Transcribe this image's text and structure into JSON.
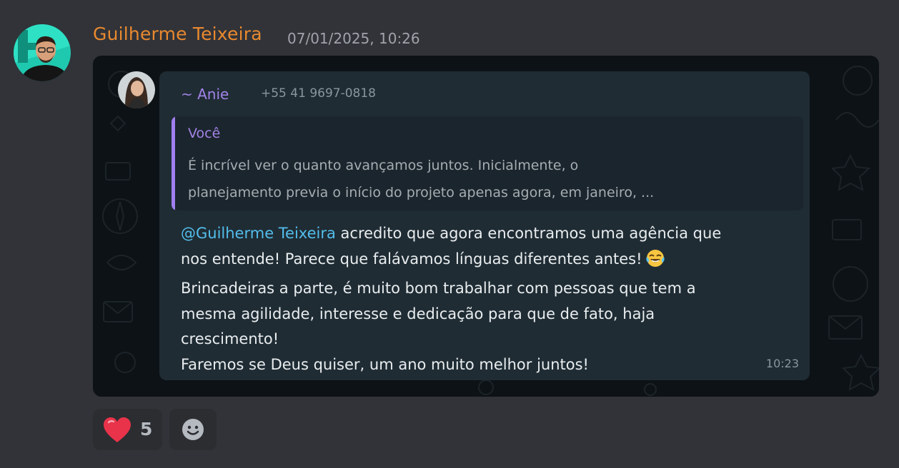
{
  "message": {
    "author": "Guilherme Teixeira",
    "timestamp": "07/01/2025, 10:26"
  },
  "attachment": {
    "sender_name": "~ Anie",
    "sender_phone": "+55 41 9697-0818",
    "quote": {
      "author": "Você",
      "lines": [
        "É incrível ver o quanto avançamos juntos. Inicialmente, o",
        "planejamento previa o início do projeto apenas agora, em janeiro, ..."
      ]
    },
    "body": {
      "mention": "@Guilherme Teixeira",
      "line1_rest": " acredito que agora encontramos uma agência que",
      "line2": "nos entende! Parece que falávamos línguas diferentes antes!",
      "emoji": "laughing-tears-emoji",
      "line3": "Brincadeiras a parte, é muito bom trabalhar com pessoas que tem a",
      "line4": "mesma agilidade, interesse e dedicação para que de fato, haja",
      "line5": "crescimento!",
      "line6": "Faremos se Deus quiser, um ano muito melhor juntos!"
    },
    "time": "10:23"
  },
  "reactions": [
    {
      "icon": "heart-icon",
      "count": "5",
      "color": "#e8334a"
    },
    {
      "icon": "add-reaction-smile-icon"
    }
  ],
  "colors": {
    "background": "#313338",
    "author": "#e8892f",
    "bubble": "#1f2c34",
    "mention": "#53bdeb",
    "quote_accent": "#a07ff0"
  }
}
